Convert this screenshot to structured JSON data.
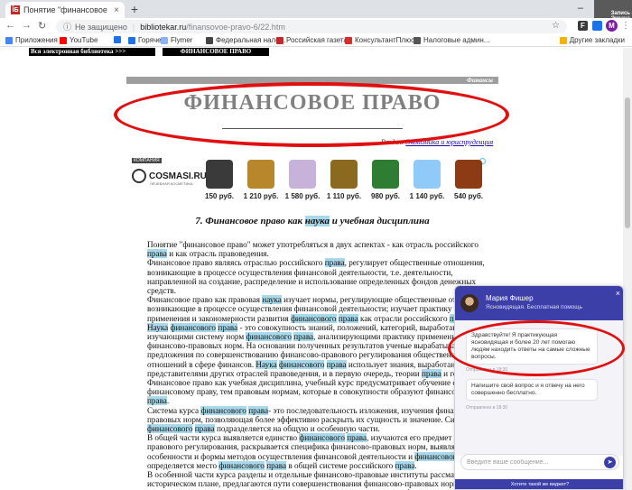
{
  "browser": {
    "tab_title": "Понятие \"финансовое право\" в",
    "tab_favicon": "ÎБ",
    "tab_close": "×",
    "new_tab": "+",
    "window_controls": {
      "minimize": "–",
      "maximize": "□",
      "close": "✕"
    },
    "corner_logo": "Запись Экрана",
    "nav": {
      "back": "←",
      "forward": "→",
      "reload": "↻"
    },
    "address": {
      "info_icon": "ⓘ",
      "security": "Не защищено",
      "separator": "|",
      "host": "bibliotekar.ru",
      "path": "/finansovoe-pravo-6/22.htm",
      "star": "☆"
    },
    "extension_label": "F",
    "profile_initial": "M",
    "menu": "⋮"
  },
  "bookmarks": {
    "items": [
      {
        "label": "Приложения",
        "color": "#4285f4"
      },
      {
        "label": "YouTube",
        "color": "#ff0000"
      },
      {
        "label": "",
        "color": "#1a73e8"
      },
      {
        "label": "Горячее",
        "color": "#1a73e8"
      },
      {
        "label": "Flymer",
        "color": "#8ab4f8"
      },
      {
        "label": "Федеральная нало...",
        "color": "#444444"
      },
      {
        "label": "Российская газета",
        "color": "#c62828"
      },
      {
        "label": "КонсультантПлюс...",
        "color": "#d32f2f"
      },
      {
        "label": "Налоговые админ...",
        "color": "#555555"
      }
    ],
    "other": "Другие закладки"
  },
  "page": {
    "topnav_left": "Вся электронная библиотека >>>",
    "topnav_right": "ФИНАНСОВОЕ ПРАВО",
    "category": "Финансы",
    "title": "ФИНАНСОВОЕ ПРАВО",
    "section_prefix": "Раздел:",
    "section_link": "Экономика и юриспруденция",
    "article_heading_pre": "7. Финансовое право как ",
    "article_heading_hl": "наука",
    "article_heading_post": " и учебная дисциплина"
  },
  "ad": {
    "tag": "КОМПАНИЯ",
    "brand": "COSMASI.RU",
    "brand_sub": "ЛЕЧЕБНАЯ КОСМЕТИКА",
    "products": [
      {
        "price": "150 руб.",
        "color": "#3a3a3a"
      },
      {
        "price": "1 210 руб.",
        "color": "#b8862b"
      },
      {
        "price": "1 580 руб.",
        "color": "#c7b3d9"
      },
      {
        "price": "1 110 руб.",
        "color": "#8b6a1f"
      },
      {
        "price": "980 руб.",
        "color": "#2e7d32"
      },
      {
        "price": "1 140 руб.",
        "color": "#90caf9"
      },
      {
        "price": "540 руб.",
        "color": "#8d3b14"
      }
    ]
  },
  "article": {
    "paragraphs": [
      "Понятие \"финансовое право\" может употребляться в двух аспектах - как отрасль российского [[права]] и как отрасль правоведения.",
      "Финансовое право являясь отраслью российского [[права]], регулирует общественные отношения, возникающие в процессе осуществления финансовой деятельности, т.е. деятельности, направленной на создание, распределение и использование определенных фондов денежных средств.",
      "Финансовое право как правовая [[наука]] изучает нормы, регулирующие общественные отношения, возникающие в процессе осуществления финансовой деятельности; изучает практику их применения и закономерности развития [[финансового]] [[права]] как отрасли российского [[права]].",
      "[[Наука]] [[финансового]] [[права]] - это совокупность знаний, положений, категорий, выработанных изучающими систему норм [[финансового]] [[права]], анализирующими практику применения финансово-правовых норм. На основании полученных результатов ученые вырабатывают предложения по совершенствованию финансово-правового регулирования общественных отношений в сфере финансов. [[Наука]] [[финансового]] [[права]] использует знания, выработанные представителями других отраслей правоведения, и в первую очередь, теории [[права]] и государства.",
      "Финансовое право как учебная дисциплина, учебный курс предусматривает обучение студентов финансовому праву, тем правовым нормам, которые в совокупности образуют финансовое [[право]] [[права]].",
      "Система курса [[финансового]] [[права]]- это последовательность изложения, изучения финансово-правовых норм, позволяющая более эффективно раскрыть их сущность и значение. Система курса [[финансового]] [[права]] подразделяется на общую и особенную части.",
      "В общей части курса выявляется единство [[финансового]] [[права]], изучаются его предмет и метод правового регулирования, раскрывается специфика финансово-правовых норм, выявляются особенности и формы методов осуществления финансовой деятельности и [[финансового]] [[контроля]], определяется место [[финансового]] [[права]] в общей системе российского [[права]].",
      "В особенной части курса разделы и отдельные финансово-правовые институты рассматриваются в историческом плане, предлагаются пути совершенствования финансово-правовых норм, проводится сравнительно-правовой анализ соответствующих разделов и финансово-правовых институтов."
    ]
  },
  "chat": {
    "agent_name": "Мария Фишер",
    "agent_status": "Ясновидящая. Бесплатная помощь",
    "close": "×",
    "message1": "Здравствуйте! Я практикующая ясновидящая и более 20 лет помогаю людям находить ответы на самые сложные вопросы.",
    "message1_time": "Отправлено в 18:30",
    "message2": "Напишите свой вопрос и я отвечу на него совершенно бесплатно.",
    "message2_time": "Отправлено в 18:30",
    "input_placeholder": "Введите ваше сообщение...",
    "send": "➤",
    "footer": "Хотите такой же виджет?"
  },
  "colors": {
    "annotation_red": "#e01010",
    "chat_accent": "#3d3fa8",
    "highlight": "#a8d8ea"
  }
}
